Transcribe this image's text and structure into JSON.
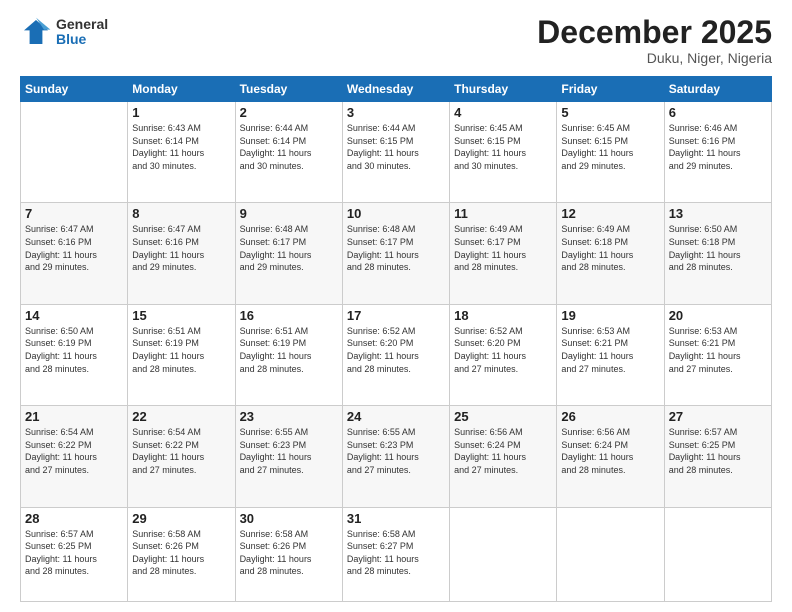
{
  "logo": {
    "general": "General",
    "blue": "Blue"
  },
  "title": "December 2025",
  "location": "Duku, Niger, Nigeria",
  "days_header": [
    "Sunday",
    "Monday",
    "Tuesday",
    "Wednesday",
    "Thursday",
    "Friday",
    "Saturday"
  ],
  "weeks": [
    [
      {
        "day": "",
        "info": ""
      },
      {
        "day": "1",
        "info": "Sunrise: 6:43 AM\nSunset: 6:14 PM\nDaylight: 11 hours\nand 30 minutes."
      },
      {
        "day": "2",
        "info": "Sunrise: 6:44 AM\nSunset: 6:14 PM\nDaylight: 11 hours\nand 30 minutes."
      },
      {
        "day": "3",
        "info": "Sunrise: 6:44 AM\nSunset: 6:15 PM\nDaylight: 11 hours\nand 30 minutes."
      },
      {
        "day": "4",
        "info": "Sunrise: 6:45 AM\nSunset: 6:15 PM\nDaylight: 11 hours\nand 30 minutes."
      },
      {
        "day": "5",
        "info": "Sunrise: 6:45 AM\nSunset: 6:15 PM\nDaylight: 11 hours\nand 29 minutes."
      },
      {
        "day": "6",
        "info": "Sunrise: 6:46 AM\nSunset: 6:16 PM\nDaylight: 11 hours\nand 29 minutes."
      }
    ],
    [
      {
        "day": "7",
        "info": "Sunrise: 6:47 AM\nSunset: 6:16 PM\nDaylight: 11 hours\nand 29 minutes."
      },
      {
        "day": "8",
        "info": "Sunrise: 6:47 AM\nSunset: 6:16 PM\nDaylight: 11 hours\nand 29 minutes."
      },
      {
        "day": "9",
        "info": "Sunrise: 6:48 AM\nSunset: 6:17 PM\nDaylight: 11 hours\nand 29 minutes."
      },
      {
        "day": "10",
        "info": "Sunrise: 6:48 AM\nSunset: 6:17 PM\nDaylight: 11 hours\nand 28 minutes."
      },
      {
        "day": "11",
        "info": "Sunrise: 6:49 AM\nSunset: 6:17 PM\nDaylight: 11 hours\nand 28 minutes."
      },
      {
        "day": "12",
        "info": "Sunrise: 6:49 AM\nSunset: 6:18 PM\nDaylight: 11 hours\nand 28 minutes."
      },
      {
        "day": "13",
        "info": "Sunrise: 6:50 AM\nSunset: 6:18 PM\nDaylight: 11 hours\nand 28 minutes."
      }
    ],
    [
      {
        "day": "14",
        "info": "Sunrise: 6:50 AM\nSunset: 6:19 PM\nDaylight: 11 hours\nand 28 minutes."
      },
      {
        "day": "15",
        "info": "Sunrise: 6:51 AM\nSunset: 6:19 PM\nDaylight: 11 hours\nand 28 minutes."
      },
      {
        "day": "16",
        "info": "Sunrise: 6:51 AM\nSunset: 6:19 PM\nDaylight: 11 hours\nand 28 minutes."
      },
      {
        "day": "17",
        "info": "Sunrise: 6:52 AM\nSunset: 6:20 PM\nDaylight: 11 hours\nand 28 minutes."
      },
      {
        "day": "18",
        "info": "Sunrise: 6:52 AM\nSunset: 6:20 PM\nDaylight: 11 hours\nand 27 minutes."
      },
      {
        "day": "19",
        "info": "Sunrise: 6:53 AM\nSunset: 6:21 PM\nDaylight: 11 hours\nand 27 minutes."
      },
      {
        "day": "20",
        "info": "Sunrise: 6:53 AM\nSunset: 6:21 PM\nDaylight: 11 hours\nand 27 minutes."
      }
    ],
    [
      {
        "day": "21",
        "info": "Sunrise: 6:54 AM\nSunset: 6:22 PM\nDaylight: 11 hours\nand 27 minutes."
      },
      {
        "day": "22",
        "info": "Sunrise: 6:54 AM\nSunset: 6:22 PM\nDaylight: 11 hours\nand 27 minutes."
      },
      {
        "day": "23",
        "info": "Sunrise: 6:55 AM\nSunset: 6:23 PM\nDaylight: 11 hours\nand 27 minutes."
      },
      {
        "day": "24",
        "info": "Sunrise: 6:55 AM\nSunset: 6:23 PM\nDaylight: 11 hours\nand 27 minutes."
      },
      {
        "day": "25",
        "info": "Sunrise: 6:56 AM\nSunset: 6:24 PM\nDaylight: 11 hours\nand 27 minutes."
      },
      {
        "day": "26",
        "info": "Sunrise: 6:56 AM\nSunset: 6:24 PM\nDaylight: 11 hours\nand 28 minutes."
      },
      {
        "day": "27",
        "info": "Sunrise: 6:57 AM\nSunset: 6:25 PM\nDaylight: 11 hours\nand 28 minutes."
      }
    ],
    [
      {
        "day": "28",
        "info": "Sunrise: 6:57 AM\nSunset: 6:25 PM\nDaylight: 11 hours\nand 28 minutes."
      },
      {
        "day": "29",
        "info": "Sunrise: 6:58 AM\nSunset: 6:26 PM\nDaylight: 11 hours\nand 28 minutes."
      },
      {
        "day": "30",
        "info": "Sunrise: 6:58 AM\nSunset: 6:26 PM\nDaylight: 11 hours\nand 28 minutes."
      },
      {
        "day": "31",
        "info": "Sunrise: 6:58 AM\nSunset: 6:27 PM\nDaylight: 11 hours\nand 28 minutes."
      },
      {
        "day": "",
        "info": ""
      },
      {
        "day": "",
        "info": ""
      },
      {
        "day": "",
        "info": ""
      }
    ]
  ]
}
